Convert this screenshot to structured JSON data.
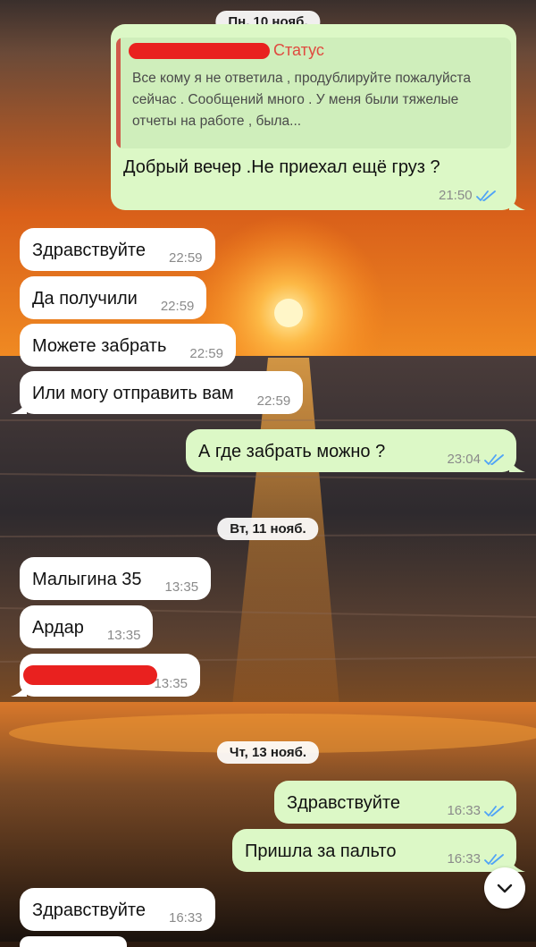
{
  "date_separators": [
    "Пн, 10 нояб.",
    "Вт, 11 нояб.",
    "Чт, 13 нояб."
  ],
  "messages": [
    {
      "direction": "out",
      "quote": {
        "label": "Статус",
        "text": "Все кому я не ответила , продублируйте пожалуйста сейчас . Сообщений много . У меня были тяжелые отчеты на работе , была..."
      },
      "text": "Добрый вечер .Не приехал ещё груз ?",
      "time": "21:50",
      "status": "read"
    },
    {
      "direction": "in",
      "text": "Здравствуйте",
      "time": "22:59"
    },
    {
      "direction": "in",
      "text": "Да получили",
      "time": "22:59"
    },
    {
      "direction": "in",
      "text": "Можете забрать",
      "time": "22:59"
    },
    {
      "direction": "in",
      "text": "Или могу отправить вам",
      "time": "22:59"
    },
    {
      "direction": "out",
      "text": "А где забрать можно ?",
      "time": "23:04",
      "status": "read"
    },
    {
      "direction": "in",
      "text": "Малыгина 35",
      "time": "13:35"
    },
    {
      "direction": "in",
      "text": "Ардар",
      "time": "13:35"
    },
    {
      "direction": "in",
      "text": "[redacted]",
      "time": "13:35"
    },
    {
      "direction": "out",
      "text": "Здравствуйте",
      "time": "16:33",
      "status": "read"
    },
    {
      "direction": "out",
      "text": "Пришла за пальто",
      "time": "16:33",
      "status": "read"
    },
    {
      "direction": "in",
      "text": "Здравствуйте",
      "time": "16:33"
    }
  ],
  "colors": {
    "outgoing_bubble": "#dcf8c6",
    "incoming_bubble": "#ffffff",
    "read_ticks": "#4fa3f7",
    "quote_accent": "#e04a3f",
    "redaction": "#e9211f"
  },
  "scroll_button": {
    "icon": "chevron-down-icon"
  }
}
